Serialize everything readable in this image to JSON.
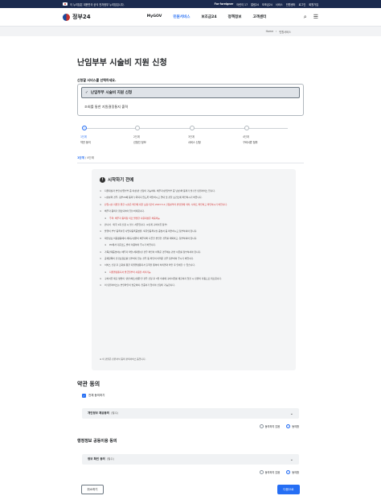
{
  "topbar": {
    "notice": "이 누리집은 대한민국 공식 전자정부 누리집입니다.",
    "links": [
      "For foreigner",
      "어린이 17",
      "알림24",
      "보조금24",
      "서비스",
      "민원센터",
      "로그인",
      "회원가입"
    ]
  },
  "header": {
    "logo": "정부24",
    "nav": [
      "MyGOV",
      "민원서비스",
      "보조금24",
      "정책정보",
      "고객센터"
    ],
    "active_nav_index": 1
  },
  "breadcrumb": [
    "Home",
    "민원서비스"
  ],
  "main": {
    "title": "난임부부 시술비 지원 신청",
    "select_label": "신청할 서비스를 선택하세요.",
    "options": [
      "난임부부 시술비 지원 신청",
      "조회를 통한 지원결정통지 출력"
    ],
    "selected_index": 0
  },
  "steps": [
    {
      "num": "1단계",
      "name": "약관 동의"
    },
    {
      "num": "2단계",
      "name": "신청인 정보"
    },
    {
      "num": "3단계",
      "name": "서비스 신청"
    },
    {
      "num": "4단계",
      "name": "구비서류 첨부"
    }
  ],
  "step_counter": {
    "current": "1단계",
    "total": "/ 4단계"
  },
  "guide": {
    "title": "시작하기 전에",
    "lines": [
      {
        "text": "지원대상자 본인(난임부부 중 여성)만 신청이 가능하며, 배우자(난임부부 중 남성)와 동의가 필수인 민원서비스 입니다.",
        "type": "normal"
      },
      {
        "text": "시술분의 경우, 정부24에 동의 누락되지 않도록 확인하시고 연내 및 관할 보건소에 확인하시기 바랍니다.",
        "type": "normal"
      },
      {
        "text": "난임시술 지원을 위한 시술은 확인에 대한 보장기간이 2023.5.2 신청분부터 변경될에 따라, 사이트 확인하고 확인하시기 바랍니다.",
        "type": "red"
      },
      {
        "text": "배우자 동의가 완료되어야 접수처리됩니다.",
        "type": "normal"
      },
      {
        "text": "주의: 배우자 동의창 미로 발생한 사용대상은 처음이능",
        "type": "sub"
      },
      {
        "text": "만나서 · 외국 1회 신청 시 필수 서류입니다. (2단계 구비서류 참부)",
        "type": "normal"
      },
      {
        "text": "발행이 부부 등록서류 사업자등록증명원, 외국인등록사실 증명서 등 확인하시고 첨부하셔야 합니다.",
        "type": "normal"
      },
      {
        "text": "제안정보 이용활동에서 세대구성원이 배우자와 다른인 본인인 경우를 제외하고, 첨부하셔야 합니다.",
        "type": "normal"
      },
      {
        "text": "PC에서 다운로드 받아 이용하여 주시기 바랍니다.",
        "type": "note"
      },
      {
        "text": "가족관계증명서는 배우자 확인(세대원)된 경우 확인이 어려운 경우에는 관련 서류를 첨부하셔야 합니다.",
        "type": "normal"
      },
      {
        "text": "공제항목이 건강보험료를 납부하지 않는 경우 등 확인이 어려운 경우 첨부하여 주시기 바랍니다.",
        "type": "normal"
      },
      {
        "text": "서비스 신청 후 조회를 통한 지원결정통지서 출력을 통하여 처리결과 확인 후 인쇄할 수 있습니다.",
        "type": "normal"
      },
      {
        "text": "지원결정통지서 발급일부터 사용을 처리가능",
        "type": "sub"
      },
      {
        "text": "구비서류 제출 방법이 '관련(팩스)방문'인 경우 신청 후 3일 이내에 구비서류를 제출하지 않을 시 민원이 자동으로 취소됩니다.",
        "type": "normal"
      },
      {
        "text": "이 민원서비스는 본인확인이 필요하며, 인증서가 있어야 신청이 가능합니다.",
        "type": "normal"
      }
    ],
    "footer": "※ 이 민원은 민원서식 등의 편의서비스 등입니다."
  },
  "terms": {
    "title": "약관 동의",
    "agree_all": "전체 동의하기",
    "items": [
      {
        "label": "개인정보 제공동의",
        "tag": "(필수)"
      },
      {
        "label": "정보 확인 동의",
        "tag": "(필수)"
      }
    ],
    "radio_disagree": "동의하지 않음",
    "radio_agree": "동의함",
    "section2_title": "행정정보 공동이용 동의"
  },
  "buttons": {
    "cancel": "취소하기",
    "next": "다음으로"
  },
  "colors": {
    "accent": "#256ef4",
    "topbar": "#1b2a4e",
    "warning": "#d32f2f"
  }
}
